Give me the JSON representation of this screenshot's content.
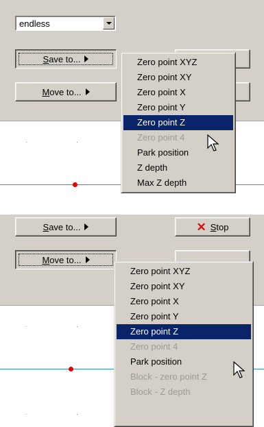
{
  "top": {
    "combo_value": "endless",
    "save_button": "Save to...",
    "move_button": "Move to...",
    "menu_items": [
      {
        "label": "Zero point XYZ",
        "state": "normal"
      },
      {
        "label": "Zero point XY",
        "state": "normal"
      },
      {
        "label": "Zero point X",
        "state": "normal"
      },
      {
        "label": "Zero point Y",
        "state": "normal"
      },
      {
        "label": "Zero point Z",
        "state": "selected"
      },
      {
        "label": "Zero point 4",
        "state": "disabled"
      },
      {
        "label": "Park position",
        "state": "normal"
      },
      {
        "label": "Z depth",
        "state": "normal"
      },
      {
        "label": "Max Z depth",
        "state": "normal"
      }
    ]
  },
  "bottom": {
    "save_button": "Save to...",
    "move_button": "Move to...",
    "stop_button": "Stop",
    "menu_items": [
      {
        "label": "Zero point XYZ",
        "state": "normal"
      },
      {
        "label": "Zero point XY",
        "state": "normal"
      },
      {
        "label": "Zero point X",
        "state": "normal"
      },
      {
        "label": "Zero point Y",
        "state": "normal"
      },
      {
        "label": "Zero point Z",
        "state": "selected"
      },
      {
        "label": "Zero point 4",
        "state": "disabled"
      },
      {
        "label": "Park position",
        "state": "normal"
      },
      {
        "label": "Block - zero point Z",
        "state": "disabled"
      },
      {
        "label": "Block - Z depth",
        "state": "disabled"
      }
    ]
  },
  "colors": {
    "selection": "#0a246a",
    "axis": "#2f8fe0",
    "marker": "#e00000",
    "stop_icon": "#d01010"
  }
}
